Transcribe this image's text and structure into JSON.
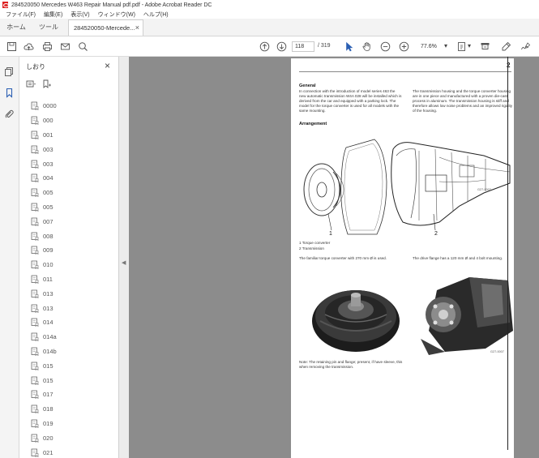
{
  "window": {
    "title": "284520050 Mercedes W463 Repair Manual pdf.pdf - Adobe Acrobat Reader DC"
  },
  "menu": [
    "ファイル(F)",
    "編集(E)",
    "表示(V)",
    "ウィンドウ(W)",
    "ヘルプ(H)"
  ],
  "tabs": {
    "home": "ホーム",
    "tools": "ツール",
    "document": "284520050-Mercede...",
    "close_glyph": "×"
  },
  "toolbar": {
    "page_current": "118",
    "page_total": "/ 319",
    "zoom": "77.6%"
  },
  "panel": {
    "title": "しおり",
    "close_glyph": "×",
    "bookmarks": [
      "0000",
      "000",
      "001",
      "003",
      "003",
      "004",
      "005",
      "005",
      "007",
      "008",
      "009",
      "010",
      "011",
      "013",
      "013",
      "014",
      "014a",
      "014b",
      "015",
      "015",
      "017",
      "018",
      "019",
      "020",
      "021"
    ]
  },
  "document": {
    "page_number": "2",
    "section_general": "General",
    "general_text": "In connection with the introduction of model series 463 the new automatic transmission W4A 028 will be installed which is derived from the car and equipped with a parking lock. The model for the torque converter is used for all models with the same mounting.",
    "right_text": "The transmission housing and the torque converter housing are in one piece and manufactured with a proven die-cast process in aluminum. The transmission housing is stiff and therefore allows low noise problems and an improved rigidity of the housing.",
    "section_arrangement": "Arrangement",
    "callout_1": "1",
    "callout_2": "2",
    "legend_1": "1  Torque converter",
    "legend_2": "2  Transmission",
    "caption_left": "The familiar torque converter with 270 mm Ø is used.",
    "caption_right": "The drive flange has a 120 mm Ø and 4 bolt mounting.",
    "note_text": "Note: The retaining pin and flange; present, if have sleeve, this when removing the transmission.",
    "figure_code_1": "G27-0003",
    "figure_code_2": "G27-0007"
  },
  "colors": {
    "accent": "#d22222",
    "viewport_bg": "#8c8c8c",
    "scroll_thumb": "#c2c2c2"
  }
}
